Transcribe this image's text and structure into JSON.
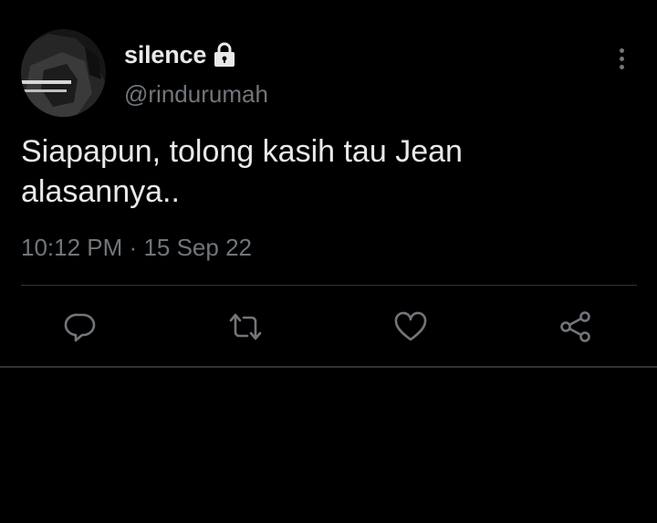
{
  "tweet": {
    "display_name": "silence",
    "handle": "@rindurumah",
    "text": "Siapapun, tolong kasih tau Jean alasannya..",
    "time": "10:12 PM",
    "separator": "·",
    "date": "15 Sep 22"
  },
  "icons": {
    "lock": "lock-icon",
    "more": "more-vertical-icon",
    "reply": "reply-icon",
    "retweet": "retweet-icon",
    "like": "heart-icon",
    "share": "share-icon"
  },
  "colors": {
    "background": "#000000",
    "primary_text": "#e7e9ea",
    "secondary_text": "#71767b",
    "divider": "#2f3336"
  }
}
